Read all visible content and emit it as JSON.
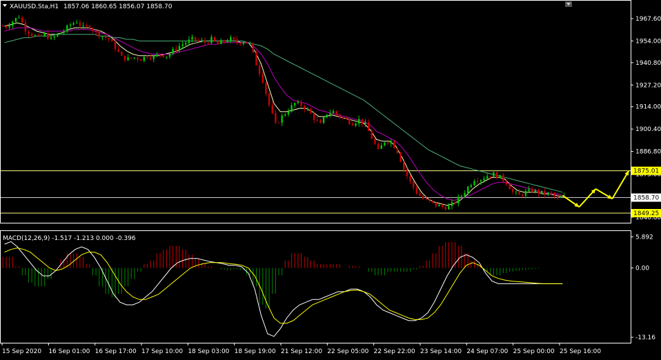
{
  "header": {
    "menu_icon": "triangle-down-icon",
    "symbol": "XAUUSD.Sta,H1",
    "ohlc": "1857.06 1860.65 1856.07 1858.70"
  },
  "indicator": {
    "label": "MACD(12,26,9) -1.517 -1.213 0.000 -0.396"
  },
  "colors": {
    "background": "#000000",
    "axis": "#ffffff",
    "bull_candle": "#00cc00",
    "bear_candle": "#cc0000",
    "ma_fast": "#ffffc0",
    "ma_mid": "#c000c0",
    "ma_slow": "#4caf7a",
    "hline": "#ffff80",
    "price_line": "#c8c8c8",
    "arrow": "#ffff00",
    "macd_line": "#ffffff",
    "signal_line": "#ffff00",
    "hist_pos": "#cc0000",
    "hist_neg": "#008800",
    "price_tag": "#ffff00"
  },
  "chart_data": [
    {
      "type": "candlestick",
      "price_axis_ticks": [
        "1967.60",
        "1954.00",
        "1940.80",
        "1927.20",
        "1914.00",
        "1900.40",
        "1886.80",
        "1873.00",
        "1859.60",
        "1846.80"
      ],
      "ylim": [
        1843.4,
        1978.5
      ],
      "x_tick_labels": [
        "15 Sep 2020",
        "16 Sep 01:00",
        "16 Sep 17:00",
        "17 Sep 10:00",
        "18 Sep 03:00",
        "18 Sep 19:00",
        "21 Sep 12:00",
        "22 Sep 05:00",
        "22 Sep 22:00",
        "23 Sep 14:00",
        "24 Sep 07:00",
        "25 Sep 00:00",
        "25 Sep 16:00"
      ],
      "horizontal_lines": [
        {
          "price": 1875.01,
          "label": "1875.01"
        },
        {
          "price": 1858.7,
          "label": "1858.70"
        },
        {
          "price": 1849.25,
          "label": "1849.25"
        }
      ],
      "close_path": [
        1963,
        1966,
        1969,
        1961,
        1958,
        1956,
        1958,
        1955,
        1958,
        1960,
        1964,
        1966,
        1962,
        1963,
        1959,
        1957,
        1955,
        1950,
        1944,
        1943,
        1944,
        1943,
        1945,
        1944,
        1946,
        1945,
        1948,
        1951,
        1953,
        1955,
        1954,
        1953,
        1955,
        1952,
        1954,
        1955,
        1953,
        1954,
        1952,
        1940,
        1930,
        1915,
        1903,
        1908,
        1912,
        1916,
        1915,
        1912,
        1907,
        1903,
        1910,
        1911,
        1908,
        1906,
        1904,
        1906,
        1903,
        1895,
        1887,
        1893,
        1893,
        1887,
        1876,
        1868,
        1862,
        1858,
        1856,
        1854,
        1853,
        1853,
        1856,
        1860,
        1865,
        1870,
        1870,
        1872,
        1873,
        1871,
        1868,
        1862,
        1860,
        1862,
        1863,
        1862,
        1861,
        1861,
        1858,
        1858.7
      ],
      "moving_averages": {
        "fast": [
          1963,
          1964,
          1965,
          1964,
          1962,
          1960,
          1959,
          1958,
          1958,
          1959,
          1961,
          1962,
          1962,
          1962,
          1961,
          1960,
          1958,
          1955,
          1951,
          1948,
          1946,
          1945,
          1945,
          1945,
          1945,
          1946,
          1947,
          1948,
          1950,
          1952,
          1953,
          1954,
          1954,
          1954,
          1954,
          1954,
          1954,
          1953,
          1953,
          1948,
          1940,
          1928,
          1916,
          1911,
          1911,
          1912,
          1913,
          1913,
          1911,
          1908,
          1908,
          1909,
          1908,
          1907,
          1906,
          1905,
          1904,
          1900,
          1894,
          1893,
          1893,
          1890,
          1883,
          1875,
          1868,
          1862,
          1858,
          1856,
          1855,
          1854,
          1855,
          1857,
          1860,
          1864,
          1867,
          1869,
          1871,
          1871,
          1870,
          1866,
          1863,
          1862,
          1862,
          1862,
          1861,
          1861,
          1860,
          1859
        ],
        "mid": [
          1960,
          1961,
          1962,
          1962,
          1962,
          1961,
          1960,
          1960,
          1960,
          1960,
          1960,
          1961,
          1961,
          1961,
          1960,
          1959,
          1958,
          1956,
          1954,
          1952,
          1950,
          1948,
          1947,
          1946,
          1946,
          1946,
          1946,
          1947,
          1948,
          1949,
          1950,
          1951,
          1952,
          1952,
          1953,
          1953,
          1953,
          1953,
          1953,
          1950,
          1946,
          1940,
          1932,
          1926,
          1921,
          1918,
          1917,
          1916,
          1914,
          1912,
          1911,
          1910,
          1909,
          1908,
          1907,
          1906,
          1905,
          1903,
          1899,
          1897,
          1895,
          1893,
          1889,
          1884,
          1878,
          1872,
          1867,
          1863,
          1860,
          1858,
          1857,
          1858,
          1859,
          1861,
          1863,
          1865,
          1867,
          1868,
          1868,
          1867,
          1866,
          1865,
          1864,
          1863,
          1862,
          1861,
          1861,
          1860
        ],
        "slow": [
          1953,
          1954,
          1955,
          1956,
          1956,
          1957,
          1957,
          1957,
          1958,
          1958,
          1958,
          1958,
          1958,
          1958,
          1958,
          1957,
          1957,
          1956,
          1956,
          1955,
          1955,
          1954,
          1954,
          1954,
          1954,
          1954,
          1954,
          1954,
          1954,
          1954,
          1954,
          1954,
          1954,
          1954,
          1954,
          1954,
          1954,
          1954,
          1953,
          1952,
          1951,
          1949,
          1946,
          1944,
          1942,
          1940,
          1938,
          1936,
          1934,
          1932,
          1930,
          1928,
          1926,
          1924,
          1922,
          1920,
          1918,
          1915,
          1912,
          1909,
          1906,
          1903,
          1900,
          1897,
          1894,
          1891,
          1888,
          1886,
          1884,
          1882,
          1880,
          1878,
          1877,
          1876,
          1875,
          1874,
          1873,
          1872,
          1871,
          1870,
          1869,
          1868,
          1867,
          1866,
          1865,
          1864,
          1863,
          1862
        ]
      },
      "projection_arrows": [
        {
          "from": 1860,
          "to": 1853
        },
        {
          "from": 1853,
          "to": 1864
        },
        {
          "from": 1864,
          "to": 1858
        },
        {
          "from": 1858,
          "to": 1875
        }
      ]
    },
    {
      "type": "histogram+line",
      "name": "MACD(12,26,9)",
      "ticks": [
        "5.892",
        "0.00",
        "-13.16"
      ],
      "ylim": [
        -14.2,
        7.0
      ],
      "macd": [
        4.5,
        5.0,
        4.0,
        2.5,
        1.0,
        -0.5,
        -1.5,
        -1.5,
        -0.5,
        1.0,
        2.5,
        3.5,
        4.0,
        3.5,
        2.0,
        0.0,
        -2.5,
        -5.0,
        -6.5,
        -7.0,
        -7.0,
        -6.5,
        -5.5,
        -4.5,
        -3.0,
        -1.5,
        0.0,
        1.0,
        1.5,
        1.8,
        1.8,
        1.5,
        1.2,
        1.0,
        0.8,
        0.5,
        0.5,
        0.2,
        -1.0,
        -4.0,
        -9.0,
        -12.5,
        -13.0,
        -11.5,
        -9.5,
        -8.0,
        -7.0,
        -6.5,
        -6.0,
        -6.0,
        -5.5,
        -5.0,
        -4.5,
        -4.5,
        -4.0,
        -4.0,
        -4.5,
        -5.5,
        -7.0,
        -8.0,
        -8.5,
        -9.0,
        -9.5,
        -10.0,
        -10.0,
        -9.5,
        -8.5,
        -6.5,
        -4.0,
        -1.5,
        0.5,
        2.0,
        2.5,
        2.0,
        1.0,
        -1.0,
        -2.5,
        -3.0,
        -3.0,
        -3.0,
        -3.0,
        -3.0,
        -3.0,
        -3.0,
        -3.0,
        -3.0,
        -3.0,
        -3.0
      ],
      "signal": [
        3.0,
        3.5,
        3.8,
        3.5,
        3.0,
        2.0,
        1.0,
        0.0,
        -0.5,
        -0.2,
        0.5,
        1.5,
        2.5,
        3.0,
        3.0,
        2.5,
        1.0,
        -1.0,
        -3.0,
        -4.5,
        -5.5,
        -6.0,
        -6.0,
        -5.5,
        -5.0,
        -4.0,
        -3.0,
        -2.0,
        -1.0,
        0.0,
        0.5,
        0.8,
        1.0,
        1.0,
        1.0,
        0.8,
        0.7,
        0.5,
        0.0,
        -1.5,
        -4.0,
        -7.0,
        -9.5,
        -10.5,
        -10.5,
        -10.0,
        -9.0,
        -8.0,
        -7.0,
        -6.5,
        -6.0,
        -5.5,
        -5.0,
        -4.5,
        -4.3,
        -4.2,
        -4.5,
        -5.0,
        -6.0,
        -7.0,
        -8.0,
        -8.5,
        -9.0,
        -9.5,
        -9.8,
        -9.8,
        -9.5,
        -8.5,
        -7.0,
        -5.0,
        -3.0,
        -1.0,
        0.5,
        1.0,
        0.5,
        -0.5,
        -1.5,
        -2.0,
        -2.3,
        -2.5,
        -2.6,
        -2.7,
        -2.8,
        -2.9,
        -3.0,
        -3.0,
        -3.0,
        -3.0
      ]
    }
  ]
}
